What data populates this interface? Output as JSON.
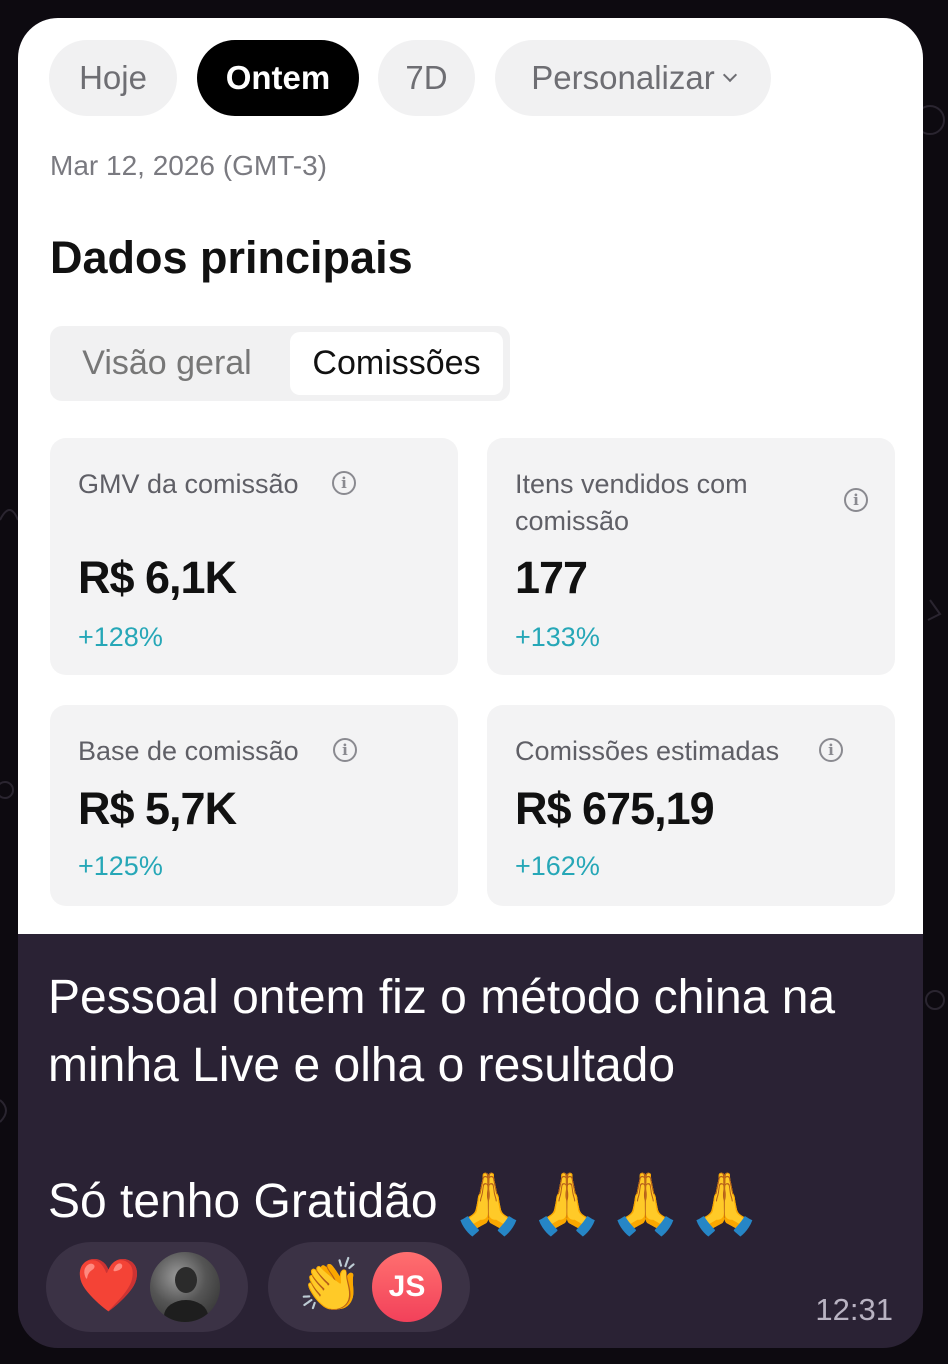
{
  "filters": {
    "today": "Hoje",
    "yesterday": "Ontem",
    "seven_days": "7D",
    "custom": "Personalizar"
  },
  "date": "Mar 12, 2026 (GMT-3)",
  "section_title": "Dados principais",
  "tabs": {
    "overview": "Visão geral",
    "commissions": "Comissões"
  },
  "metrics": [
    {
      "label": "GMV da comissão",
      "value": "R$ 6,1K",
      "change": "+128%"
    },
    {
      "label": "Itens vendidos com comissão",
      "value": "177",
      "change": "+133%"
    },
    {
      "label": "Base de comissão",
      "value": "R$ 5,7K",
      "change": "+125%"
    },
    {
      "label": "Comissões estimadas",
      "value": "R$ 675,19",
      "change": "+162%"
    }
  ],
  "message": {
    "line1": "Pessoal ontem fiz o método china na",
    "line2": "minha Live e olha o resultado",
    "line3": "Só tenho Gratidão",
    "emoji": "🙏🙏🙏🙏",
    "time": "12:31"
  },
  "reactions": [
    {
      "emoji": "❤️",
      "avatar": "photo"
    },
    {
      "emoji": "👏",
      "avatar_initials": "JS"
    }
  ],
  "colors": {
    "accent_teal": "#26a7b7",
    "bubble_bg": "#2a2234",
    "active_chip": "#000000",
    "avatar_js": "#f2415a"
  }
}
